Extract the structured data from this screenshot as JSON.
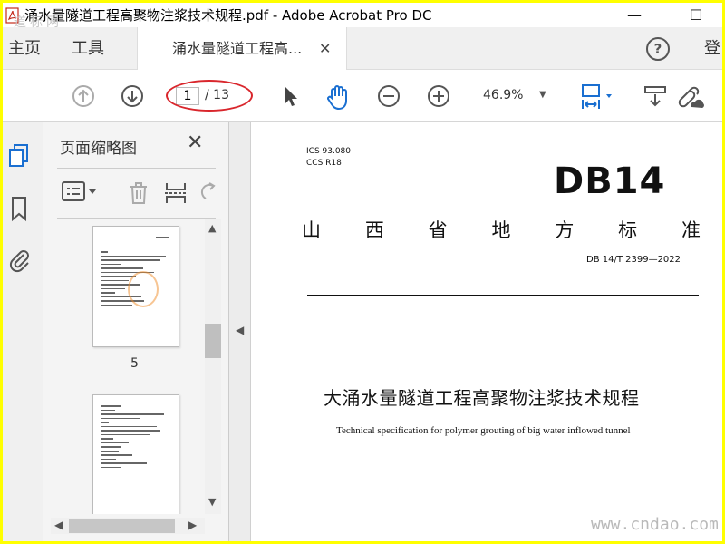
{
  "window": {
    "title": "涌水量隧道工程高聚物注浆技术规程.pdf - Adobe Acrobat Pro DC",
    "minimize": "—",
    "maximize": "☐"
  },
  "tabs": {
    "home": "主页",
    "tools": "工具",
    "document": "涌水量隧道工程高...",
    "close": "✕",
    "help": "?",
    "login": "登"
  },
  "toolbar": {
    "current_page": "1",
    "total_pages": "/ 13",
    "zoom": "46.9%",
    "zoom_caret": "▼"
  },
  "thumbnails": {
    "title": "页面缩略图",
    "close": "✕",
    "page_label": "5"
  },
  "document": {
    "ics": "ICS  93.080",
    "ccs": "CCS  R18",
    "logo": "DB14",
    "province": [
      "山",
      "西",
      "省",
      "地",
      "方",
      "标",
      "准"
    ],
    "standard_number": "DB 14/T  2399—2022",
    "title_cn": "大涌水量隧道工程高聚物注浆技术规程",
    "title_en": "Technical specification for polymer grouting of big water inflowed tunnel"
  },
  "watermarks": {
    "top": "道标网",
    "bottom": "www.cndao.com"
  },
  "colors": {
    "border": "#ffff00",
    "annotation": "#d9262c",
    "accent": "#1a6fd1"
  }
}
